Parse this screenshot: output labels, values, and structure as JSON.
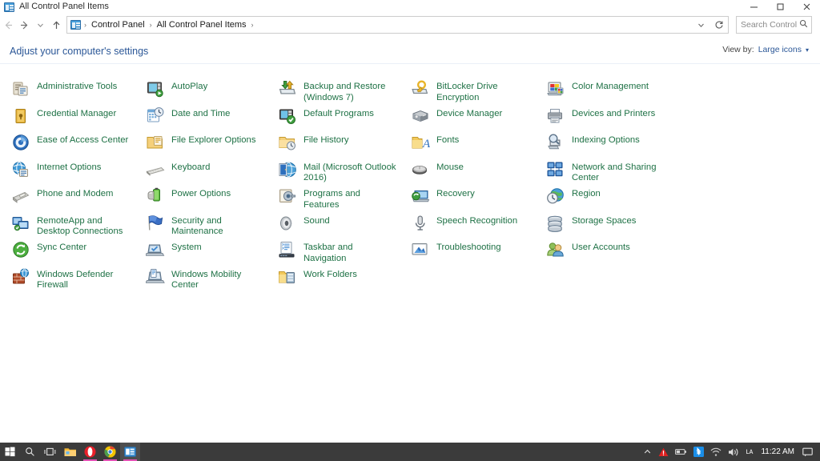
{
  "window": {
    "title": "All Control Panel Items",
    "icon": "control-panel-icon",
    "controls": {
      "minimize": "─",
      "maximize": "☐",
      "close": "✕"
    }
  },
  "navbar": {
    "back": "←",
    "forward": "→",
    "recent": "∨",
    "up": "↑",
    "breadcrumb": [
      "Control Panel",
      "All Control Panel Items"
    ],
    "separator": "›",
    "dropdown_caret": "∨",
    "refresh": "↻",
    "search": {
      "placeholder": "Search Control Panel",
      "value": "",
      "icon": "search-icon"
    }
  },
  "header": {
    "title": "Adjust your computer's settings",
    "view_by_label": "View by:",
    "view_by_value": "Large icons",
    "view_by_caret": "▾"
  },
  "grid": {
    "columns": [
      {
        "items": [
          {
            "label": "Administrative Tools",
            "icon": "administrative-tools-icon",
            "focused": false
          },
          {
            "label": "Credential Manager",
            "icon": "credential-manager-icon",
            "focused": false
          },
          {
            "label": "Ease of Access Center",
            "icon": "ease-of-access-center-icon",
            "focused": true
          },
          {
            "label": "Internet Options",
            "icon": "internet-options-icon",
            "focused": false
          },
          {
            "label": "Phone and Modem",
            "icon": "phone-and-modem-icon",
            "focused": false
          },
          {
            "label": "RemoteApp and Desktop Connections",
            "icon": "remoteapp-and-desktop-connections-icon",
            "focused": false
          },
          {
            "label": "Sync Center",
            "icon": "sync-center-icon",
            "focused": false
          },
          {
            "label": "Windows Defender Firewall",
            "icon": "windows-defender-firewall-icon",
            "focused": false
          }
        ]
      },
      {
        "items": [
          {
            "label": "AutoPlay",
            "icon": "autoplay-icon",
            "focused": false
          },
          {
            "label": "Date and Time",
            "icon": "date-and-time-icon",
            "focused": false
          },
          {
            "label": "File Explorer Options",
            "icon": "file-explorer-options-icon",
            "focused": false
          },
          {
            "label": "Keyboard",
            "icon": "keyboard-icon",
            "focused": false
          },
          {
            "label": "Power Options",
            "icon": "power-options-icon",
            "focused": false
          },
          {
            "label": "Security and Maintenance",
            "icon": "security-and-maintenance-icon",
            "focused": false
          },
          {
            "label": "System",
            "icon": "system-icon",
            "focused": false
          },
          {
            "label": "Windows Mobility Center",
            "icon": "windows-mobility-center-icon",
            "focused": false
          }
        ]
      },
      {
        "items": [
          {
            "label": "Backup and Restore (Windows 7)",
            "icon": "backup-and-restore-icon",
            "focused": false
          },
          {
            "label": "Default Programs",
            "icon": "default-programs-icon",
            "focused": false
          },
          {
            "label": "File History",
            "icon": "file-history-icon",
            "focused": false
          },
          {
            "label": "Mail (Microsoft Outlook 2016)",
            "icon": "mail-icon",
            "focused": false
          },
          {
            "label": "Programs and Features",
            "icon": "programs-and-features-icon",
            "focused": false
          },
          {
            "label": "Sound",
            "icon": "sound-icon",
            "focused": false
          },
          {
            "label": "Taskbar and Navigation",
            "icon": "taskbar-and-navigation-icon",
            "focused": false
          },
          {
            "label": "Work Folders",
            "icon": "work-folders-icon",
            "focused": false
          }
        ]
      },
      {
        "items": [
          {
            "label": "BitLocker Drive Encryption",
            "icon": "bitlocker-drive-encryption-icon",
            "focused": false
          },
          {
            "label": "Device Manager",
            "icon": "device-manager-icon",
            "focused": false
          },
          {
            "label": "Fonts",
            "icon": "fonts-icon",
            "focused": false
          },
          {
            "label": "Mouse",
            "icon": "mouse-icon",
            "focused": false
          },
          {
            "label": "Recovery",
            "icon": "recovery-icon",
            "focused": false
          },
          {
            "label": "Speech Recognition",
            "icon": "speech-recognition-icon",
            "focused": false
          },
          {
            "label": "Troubleshooting",
            "icon": "troubleshooting-icon",
            "focused": false
          }
        ]
      },
      {
        "items": [
          {
            "label": "Color Management",
            "icon": "color-management-icon",
            "focused": false
          },
          {
            "label": "Devices and Printers",
            "icon": "devices-and-printers-icon",
            "focused": false
          },
          {
            "label": "Indexing Options",
            "icon": "indexing-options-icon",
            "focused": false
          },
          {
            "label": "Network and Sharing Center",
            "icon": "network-and-sharing-center-icon",
            "focused": false
          },
          {
            "label": "Region",
            "icon": "region-icon",
            "focused": false
          },
          {
            "label": "Storage Spaces",
            "icon": "storage-spaces-icon",
            "focused": false
          },
          {
            "label": "User Accounts",
            "icon": "user-accounts-icon",
            "focused": false
          }
        ]
      }
    ]
  },
  "taskbar": {
    "buttons": [
      {
        "name": "start-button",
        "icon": "windows-logo-icon",
        "active": false,
        "running": false
      },
      {
        "name": "search-button",
        "icon": "search-icon",
        "active": false,
        "running": false
      },
      {
        "name": "task-view-button",
        "icon": "task-view-icon",
        "active": false,
        "running": false
      },
      {
        "name": "file-explorer-button",
        "icon": "folder-icon",
        "active": false,
        "running": false
      },
      {
        "name": "opera-button",
        "icon": "opera-icon",
        "active": false,
        "running": true
      },
      {
        "name": "chrome-button",
        "icon": "chrome-icon",
        "active": false,
        "running": true
      },
      {
        "name": "control-panel-button",
        "icon": "control-panel-icon",
        "active": true,
        "running": true
      }
    ],
    "tray": {
      "overflow": "∧",
      "items": [
        "warning-icon",
        "battery-icon",
        "bluetooth-icon",
        "wifi-icon",
        "volume-icon",
        "input-indicator"
      ],
      "input_indicator_label": "ʟᴀ",
      "clock": "11:22 AM",
      "action_center": "action-center-icon"
    },
    "colors": {
      "background": "#3b3b3b",
      "running_underline": "#e252b5",
      "active_background": "#4e4e4e"
    }
  },
  "colors": {
    "item_label": "#1e7145",
    "link": "#2b5797",
    "separator": "#eaf0f7",
    "focus_outline": "#000000"
  }
}
